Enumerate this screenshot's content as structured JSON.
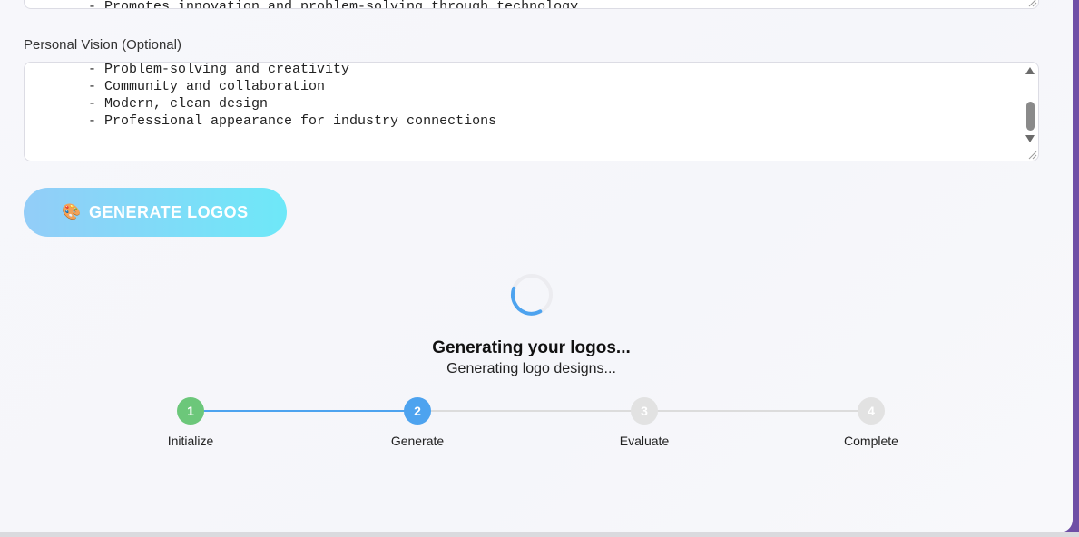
{
  "previous_field": {
    "visible_line": "  - Promotes innovation and problem-solving through technology"
  },
  "personal_vision": {
    "label": "Personal Vision (Optional)",
    "lines": [
      "  - Problem-solving and creativity",
      "  - Community and collaboration",
      "  - Modern, clean design",
      "  - Professional appearance for industry connections"
    ]
  },
  "generate_button": {
    "icon": "🎨",
    "label": "GENERATE LOGOS"
  },
  "progress": {
    "title": "Generating your logos...",
    "status": "Generating logo designs...",
    "current_step": 2,
    "steps": [
      {
        "number": "1",
        "label": "Initialize",
        "state": "completed",
        "color": "#6cc77a"
      },
      {
        "number": "2",
        "label": "Generate",
        "state": "active",
        "color": "#4da3ef"
      },
      {
        "number": "3",
        "label": "Evaluate",
        "state": "pending",
        "color": "#e2e2e2"
      },
      {
        "number": "4",
        "label": "Complete",
        "state": "pending",
        "color": "#e2e2e2"
      }
    ]
  },
  "colors": {
    "accent_blue": "#4da3ef",
    "success_green": "#6cc77a",
    "frame_purple": "#6f4fa6"
  }
}
